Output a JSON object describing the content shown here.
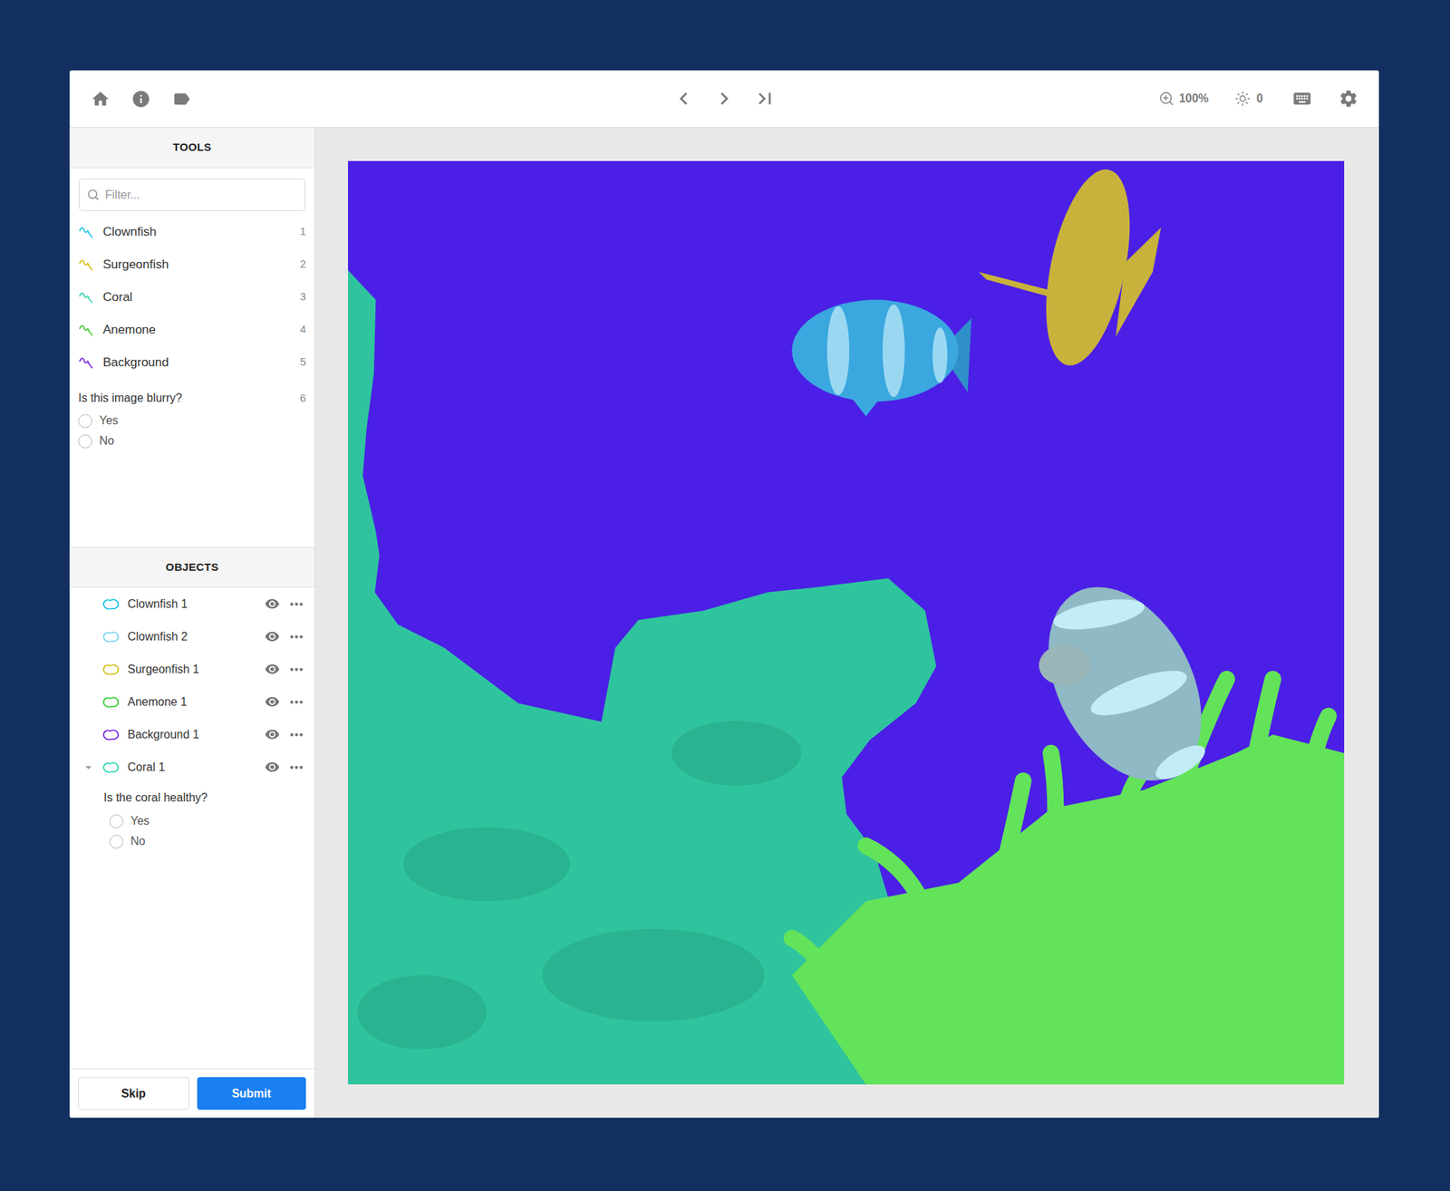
{
  "toolbar": {
    "zoom": "100%",
    "brightness": "0"
  },
  "tools_panel": {
    "title": "TOOLS",
    "filter_placeholder": "Filter...",
    "tools": [
      {
        "name": "Clownfish",
        "shortcut": "1",
        "color": "#1fc7e3"
      },
      {
        "name": "Surgeonfish",
        "shortcut": "2",
        "color": "#d8c21a"
      },
      {
        "name": "Coral",
        "shortcut": "3",
        "color": "#37d6b0"
      },
      {
        "name": "Anemone",
        "shortcut": "4",
        "color": "#4ccc3a"
      },
      {
        "name": "Background",
        "shortcut": "5",
        "color": "#7c2ee0"
      }
    ],
    "classification": {
      "question": "Is this image blurry?",
      "shortcut": "6",
      "options": [
        {
          "label": "Yes",
          "selected": false
        },
        {
          "label": "No",
          "selected": false
        }
      ]
    }
  },
  "objects_panel": {
    "title": "OBJECTS",
    "objects": [
      {
        "name": "Clownfish 1",
        "color": "#22c3e6",
        "visible": true,
        "expanded": false
      },
      {
        "name": "Clownfish 2",
        "color": "#7fd6ee",
        "visible": true,
        "expanded": false
      },
      {
        "name": "Surgeonfish 1",
        "color": "#d6c21f",
        "visible": true,
        "expanded": false
      },
      {
        "name": "Anemone 1",
        "color": "#3ccf3c",
        "visible": true,
        "expanded": false
      },
      {
        "name": "Background 1",
        "color": "#7a2be0",
        "visible": true,
        "expanded": false
      },
      {
        "name": "Coral 1",
        "color": "#2ed8b6",
        "visible": true,
        "expanded": true,
        "question": {
          "text": "Is the coral healthy?",
          "options": [
            {
              "label": "Yes",
              "selected": false
            },
            {
              "label": "No",
              "selected": false
            }
          ]
        }
      }
    ]
  },
  "buttons": [
    {
      "label": "Skip",
      "kind": "secondary"
    },
    {
      "label": "Submit",
      "kind": "primary"
    }
  ]
}
